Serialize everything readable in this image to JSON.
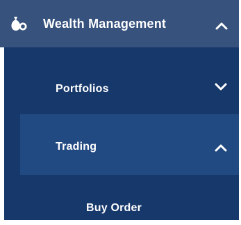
{
  "menu": {
    "title": "Wealth Management",
    "icon": "money-bag-icon",
    "expanded": true,
    "items": [
      {
        "label": "Portfolios",
        "expanded": false,
        "icon": "chevron-down-icon"
      },
      {
        "label": "Trading",
        "expanded": true,
        "icon": "chevron-up-icon",
        "children": [
          {
            "label": "Buy Order"
          }
        ]
      }
    ]
  },
  "colors": {
    "header_bg": "#36527d",
    "submenu_bg": "#17386b",
    "active_item_bg": "#214a82",
    "text": "#ffffff"
  }
}
